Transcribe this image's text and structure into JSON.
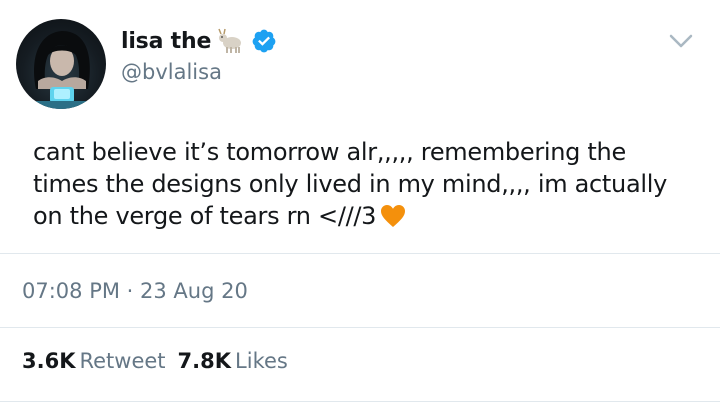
{
  "user": {
    "display_name": "lisa the",
    "handle": "@bvlalisa",
    "verified": true,
    "name_emoji": "goat-emoji"
  },
  "tweet": {
    "text": "cant believe it’s tomorrow alr,,,,, remembering the times the designs only lived in my mind,,,, im actually on the verge of tears rn <///3",
    "trailing_emoji": "orange-heart-emoji",
    "timestamp": "07:08 PM · 23 Aug 20"
  },
  "stats": {
    "retweets_count": "3.6K",
    "retweets_label": "Retweet",
    "likes_count": "7.8K",
    "likes_label": "Likes"
  },
  "colors": {
    "text": "#14171a",
    "secondary": "#657786",
    "verified": "#1da1f2",
    "divider": "#e1e8ed",
    "heart": "#f4900c"
  }
}
